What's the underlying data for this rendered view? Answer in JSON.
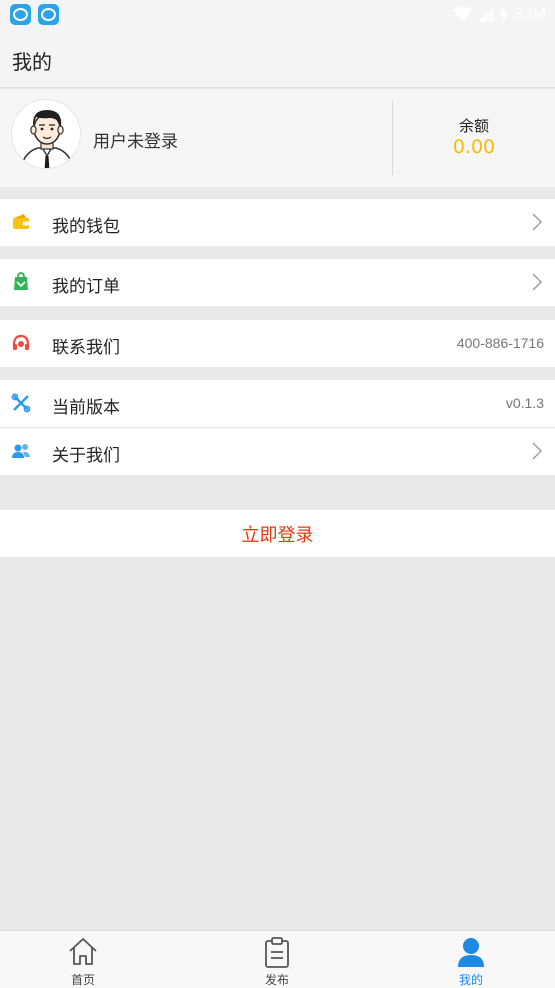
{
  "header": {
    "title": "我的"
  },
  "profile": {
    "login_status": "用户未登录",
    "balance_label": "余额",
    "balance_value": "0.00"
  },
  "menu": {
    "wallet": {
      "label": "我的钱包",
      "icon": "wallet-icon"
    },
    "orders": {
      "label": "我的订单",
      "icon": "order-icon"
    },
    "contact": {
      "label": "联系我们",
      "value": "400-886-1716",
      "icon": "headset-icon"
    },
    "version": {
      "label": "当前版本",
      "value": "v0.1.3",
      "icon": "tools-icon"
    },
    "about": {
      "label": "关于我们",
      "icon": "people-icon"
    }
  },
  "login_button": {
    "label": "立即登录"
  },
  "tabbar": {
    "items": [
      {
        "label": "首页",
        "icon": "home-icon"
      },
      {
        "label": "发布",
        "icon": "clipboard-icon"
      },
      {
        "label": "我的",
        "icon": "user-icon",
        "active": true
      }
    ]
  },
  "colors": {
    "accent_blue": "#1e88e5",
    "balance_yellow": "#f5b90d",
    "login_red": "#e8380d"
  }
}
